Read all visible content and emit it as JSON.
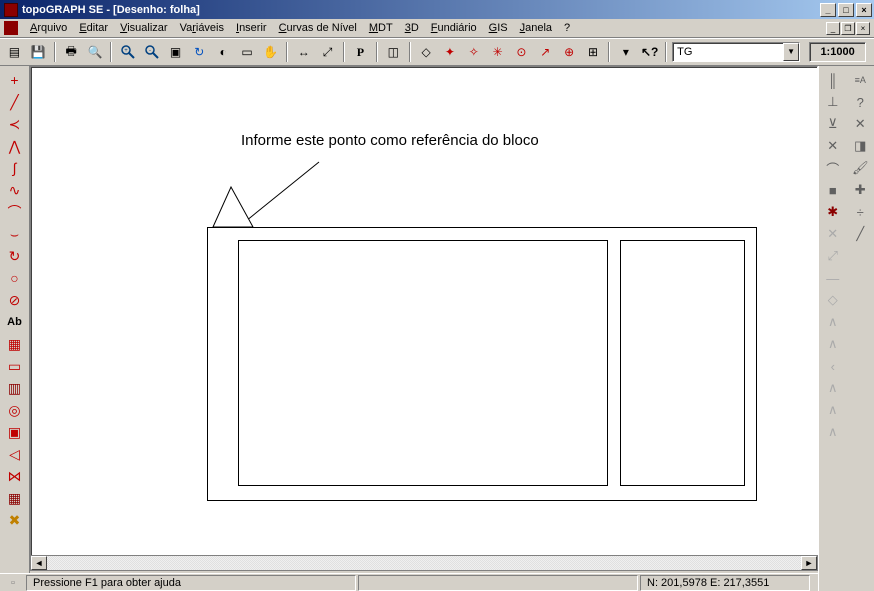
{
  "app": {
    "title": "topoGRAPH SE  -  [Desenho: folha]"
  },
  "menus": {
    "arquivo": "Arquivo",
    "editar": "Editar",
    "visualizar": "Visualizar",
    "variaveis": "Variáveis",
    "inserir": "Inserir",
    "curvas": "Curvas de Nível",
    "mdt": "MDT",
    "_3d": "3D",
    "fundiario": "Fundiário",
    "gis": "GIS",
    "janela": "Janela",
    "ajuda": "?"
  },
  "toolbar": {
    "layer_selected": "TG",
    "scale": "1:1000"
  },
  "canvas": {
    "annotation": "Informe este ponto como referência do bloco"
  },
  "status": {
    "help": "Pressione F1 para obter ajuda",
    "coords": "N: 201,5978 E: 217,3551"
  }
}
